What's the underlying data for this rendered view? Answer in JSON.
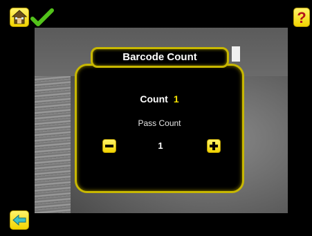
{
  "dialog": {
    "title": "Barcode Count",
    "count_label": "Count",
    "count_value": "1",
    "pass_count_label": "Pass Count",
    "pass_count_value": "1"
  },
  "icons": {
    "home": "home-icon",
    "status": "checkmark-icon",
    "help": "question-mark-icon",
    "back": "back-arrow-icon",
    "decrement": "minus-icon",
    "increment": "plus-icon"
  },
  "colors": {
    "accent": "#f5e200",
    "dialog_border": "#c8b800",
    "status_ok": "#52c21a",
    "background": "#000000"
  }
}
